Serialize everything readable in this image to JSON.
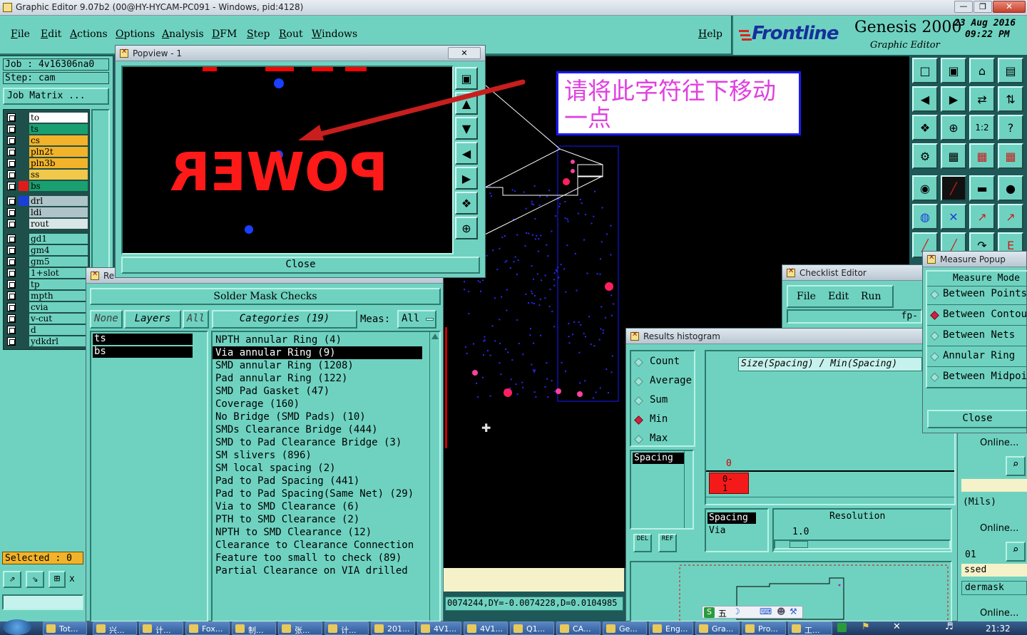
{
  "titlebar": {
    "title": "Graphic Editor 9.07b2 (00@HY-HYCAM-PC091 - Windows, pid:4128)"
  },
  "menu": {
    "items": [
      "File",
      "Edit",
      "Actions",
      "Options",
      "Analysis",
      "DFM",
      "Step",
      "Rout",
      "Windows"
    ],
    "help": "Help"
  },
  "brand": {
    "logo": "Frontline",
    "product": "Genesis 2000",
    "subtitle": "Graphic Editor",
    "date": "23 Aug 2016",
    "time": "09:22 PM"
  },
  "job": {
    "job_label": "Job : 4v16306na0",
    "step_label": "Step: cam",
    "matrix_button": "Job Matrix ..."
  },
  "layers": [
    {
      "name": "to",
      "color": "#ffffff"
    },
    {
      "name": "ts",
      "color": "#1aa070"
    },
    {
      "name": "cs",
      "color": "#f2b32a"
    },
    {
      "name": "pln2t",
      "color": "#f2b32a"
    },
    {
      "name": "pln3b",
      "color": "#f2b32a"
    },
    {
      "name": "ss",
      "color": "#f2c84a"
    },
    {
      "name": "bs",
      "color": "#1aa070"
    },
    {
      "name": "drl",
      "color": "#aec4c8"
    },
    {
      "name": "ldi",
      "color": "#aec4c8"
    },
    {
      "name": "rout",
      "color": "#d9e6e6"
    },
    {
      "name": "gd1",
      "color": "#6fd2c0"
    },
    {
      "name": "gm4",
      "color": "#6fd2c0"
    },
    {
      "name": "gm5",
      "color": "#6fd2c0"
    },
    {
      "name": "1+slot",
      "color": "#6fd2c0"
    },
    {
      "name": "tp",
      "color": "#6fd2c0"
    },
    {
      "name": "mpth",
      "color": "#6fd2c0"
    },
    {
      "name": "cvia",
      "color": "#6fd2c0"
    },
    {
      "name": "v-cut",
      "color": "#6fd2c0"
    },
    {
      "name": "d",
      "color": "#6fd2c0"
    },
    {
      "name": "ydkdrl",
      "color": "#6fd2c0"
    }
  ],
  "selected": "Selected : 0",
  "popview": {
    "title": "Popview - 1",
    "board_text": "POWER",
    "close": "Close"
  },
  "annotation": {
    "text": "请将此字符往下移动一点"
  },
  "solder_mask": {
    "window_title": "Re",
    "header": "Solder Mask Checks",
    "none_btn": "None",
    "layers_btn": "Layers",
    "all_btn": "All",
    "categories_btn": "Categories (19)",
    "meas_label": "Meas:",
    "meas_value": "All",
    "layers": [
      "ts",
      "bs"
    ],
    "categories": [
      "NPTH annular Ring (4)",
      "Via annular Ring (9)",
      "SMD annular Ring (1208)",
      "Pad annular Ring (122)",
      "SMD Pad Gasket (47)",
      "Coverage (160)",
      "No Bridge (SMD Pads) (10)",
      "SMDs Clearance Bridge (444)",
      "SMD to Pad Clearance Bridge (3)",
      "SM slivers (896)",
      "SM local spacing (2)",
      "Pad to Pad Spacing (441)",
      "Pad to Pad Spacing(Same Net) (29)",
      "Via to SMD Clearance (6)",
      "PTH to SMD Clearance (2)",
      "NPTH to SMD Clearance (12)",
      "Clearance to Clearance Connection",
      "Feature too small to check (89)",
      "Partial Clearance on VIA drilled"
    ]
  },
  "status": {
    "coords": "0074244,DY=-0.0074228,D=0.0104985"
  },
  "checklist": {
    "title": "Checklist Editor",
    "menu": [
      "File",
      "Edit",
      "Run"
    ],
    "field": "fp-"
  },
  "histogram": {
    "title": "Results histogram",
    "options": [
      "Count",
      "Average",
      "Sum",
      "Min",
      "Max"
    ],
    "selected": "Min",
    "axis_title": "Size(Spacing) / Min(Spacing)",
    "list": [
      "Spacing"
    ],
    "list2": [
      "Spacing",
      "Via"
    ],
    "bar_top": "0",
    "bar_label": "0-\n1",
    "resolution_label": "Resolution",
    "resolution_value": "1.0",
    "del_btn": "DEL",
    "ref_btn": "REF"
  },
  "measure": {
    "title": "Measure Popup",
    "header": "Measure Mode",
    "modes": [
      "Between Points",
      "Between Contours",
      "Between Nets",
      "Annular Ring",
      "Between Midpoints"
    ],
    "selected": "Between Contours",
    "close": "Close"
  },
  "right_fragments": {
    "online1": "Online...",
    "units": "(Mils)",
    "online2": "Online...",
    "val": "01",
    "passed": "ssed",
    "soldermask": "dermask",
    "online3": "Online..."
  },
  "ime": {
    "text": "五"
  },
  "taskbar": {
    "items": [
      "Tot...",
      "兴...",
      "计...",
      "Fox...",
      "制...",
      "张...",
      "计...",
      "201...",
      "4V1...",
      "4V1...",
      "Q1...",
      "CA...",
      "Ge...",
      "Eng...",
      "Gra...",
      "Pro...",
      "工..."
    ],
    "clock": "21:32"
  }
}
